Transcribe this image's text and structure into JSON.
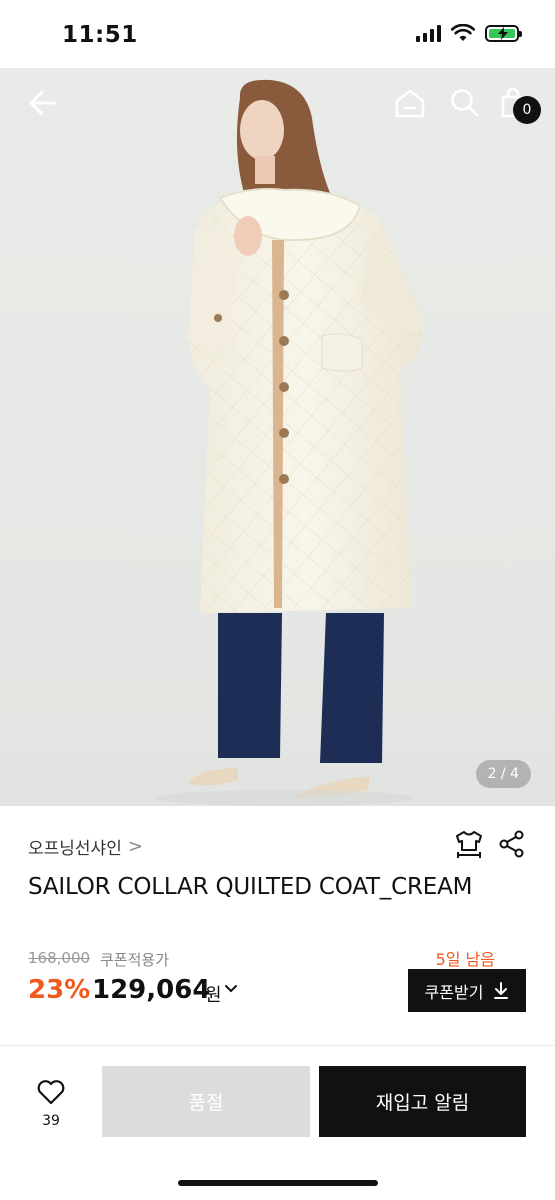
{
  "status_bar": {
    "time": "11:51"
  },
  "hero": {
    "counter": "2 / 4",
    "cart_count": "0",
    "icons": [
      "back-arrow-icon",
      "home-icon",
      "search-icon",
      "shopping-bag-icon"
    ]
  },
  "product": {
    "brand": "오프닝선샤인",
    "brand_chevron": ">",
    "title": "SAILOR COLLAR QUILTED COAT_CREAM",
    "original_price": "168,000",
    "coupon_price_label": "쿠폰적용가",
    "discount": "23%",
    "price": "129,064",
    "currency": "원",
    "days_left": "5일 남음",
    "coupon_button": "쿠폰받기"
  },
  "bottom_bar": {
    "like_count": "39",
    "soldout_label": "품절",
    "restock_label": "재입고 알림"
  },
  "colors": {
    "accent": "#ef5a1f",
    "primary": "#111111",
    "disabled": "#dcdcdc"
  }
}
